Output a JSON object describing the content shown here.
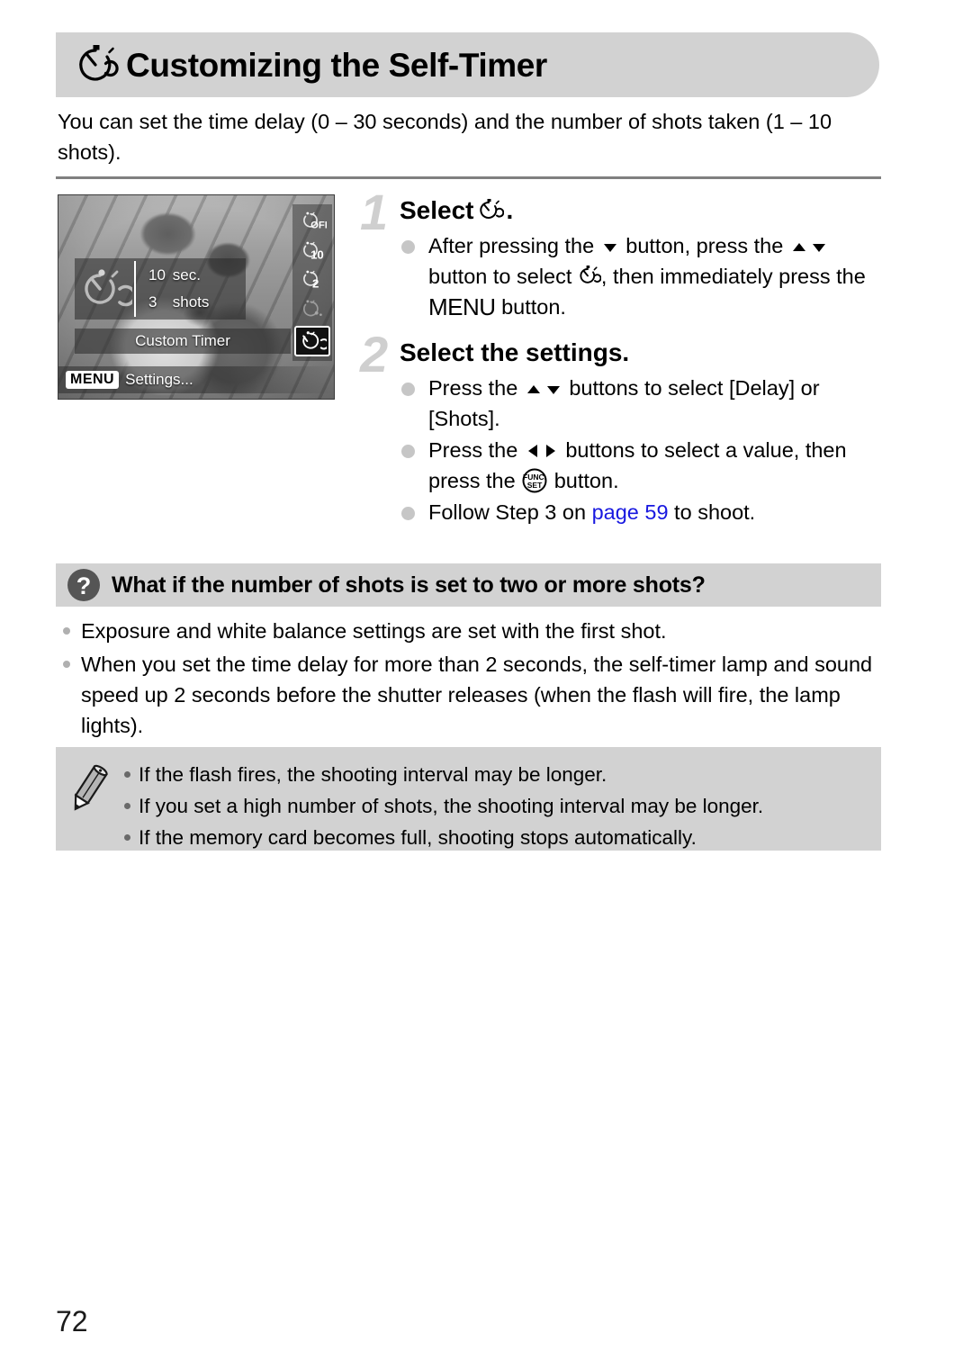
{
  "header": {
    "title": "Customizing the Self-Timer",
    "icon": "self-timer-custom-icon"
  },
  "intro": {
    "text": "You can set the time delay (0 – 30 seconds) and the number of shots taken (1 – 10 shots)."
  },
  "camera_screen": {
    "delay_value": "10",
    "delay_unit": "sec.",
    "shots_value": "3",
    "shots_unit": "shots",
    "mode_label": "Custom Timer",
    "menu_chip": "MENU",
    "menu_text": "Settings...",
    "options": [
      {
        "name": "self-timer-off",
        "label": "OFF",
        "selected": false
      },
      {
        "name": "self-timer-10sec",
        "label": "10",
        "selected": false
      },
      {
        "name": "self-timer-2sec",
        "label": "2",
        "selected": false
      },
      {
        "name": "self-timer-face",
        "label": "",
        "selected": false
      },
      {
        "name": "self-timer-custom",
        "label": "C",
        "selected": true
      }
    ]
  },
  "steps": [
    {
      "number": "1",
      "title_prefix": "Select",
      "title_suffix": ".",
      "title_icon": "self-timer-custom-icon",
      "bullets": [
        {
          "parts": [
            {
              "t": "text",
              "v": "After pressing the "
            },
            {
              "t": "icon",
              "v": "down-arrow-icon"
            },
            {
              "t": "text",
              "v": " button, press the "
            },
            {
              "t": "icon",
              "v": "up-arrow-icon"
            },
            {
              "t": "icon",
              "v": "down-arrow-icon"
            },
            {
              "t": "text",
              "v": " button to select "
            },
            {
              "t": "icon",
              "v": "self-timer-custom-icon"
            },
            {
              "t": "text",
              "v": ", then immediately press the "
            },
            {
              "t": "word",
              "v": "MENU"
            },
            {
              "t": "text",
              "v": " button."
            }
          ]
        }
      ]
    },
    {
      "number": "2",
      "title_prefix": "Select the settings.",
      "title_suffix": "",
      "title_icon": "",
      "bullets": [
        {
          "parts": [
            {
              "t": "text",
              "v": "Press the "
            },
            {
              "t": "icon",
              "v": "up-arrow-icon"
            },
            {
              "t": "icon",
              "v": "down-arrow-icon"
            },
            {
              "t": "text",
              "v": " buttons to select [Delay] or [Shots]."
            }
          ]
        },
        {
          "parts": [
            {
              "t": "text",
              "v": "Press the "
            },
            {
              "t": "icon",
              "v": "left-arrow-icon"
            },
            {
              "t": "icon",
              "v": "right-arrow-icon"
            },
            {
              "t": "text",
              "v": " buttons to select a value, then press the "
            },
            {
              "t": "icon",
              "v": "func-set-icon"
            },
            {
              "t": "text",
              "v": " button."
            }
          ]
        },
        {
          "parts": [
            {
              "t": "text",
              "v": "Follow Step 3 on "
            },
            {
              "t": "link",
              "v": "page 59"
            },
            {
              "t": "text",
              "v": " to shoot."
            }
          ]
        }
      ]
    }
  ],
  "qa": {
    "icon": "question-mark-icon",
    "title": "What if the number of shots is set to two or more shots?",
    "items": [
      "Exposure and white balance settings are set with the first shot.",
      "When you set the time delay for more than 2 seconds, the self-timer lamp and sound speed up 2 seconds before the shutter releases (when the flash will fire, the lamp lights)."
    ]
  },
  "notes": {
    "icon": "pencil-icon",
    "items": [
      "If the flash fires, the shooting interval may be longer.",
      "If you set a high number of shots, the shooting interval may be longer.",
      "If the memory card becomes full, shooting stops automatically."
    ]
  },
  "footer": {
    "page_number": "72"
  },
  "colors": {
    "bar_gray": "#d2d2d2",
    "rule_gray": "#808080",
    "link_blue": "#1818e0",
    "step_number_gray": "#cfcfcf"
  }
}
